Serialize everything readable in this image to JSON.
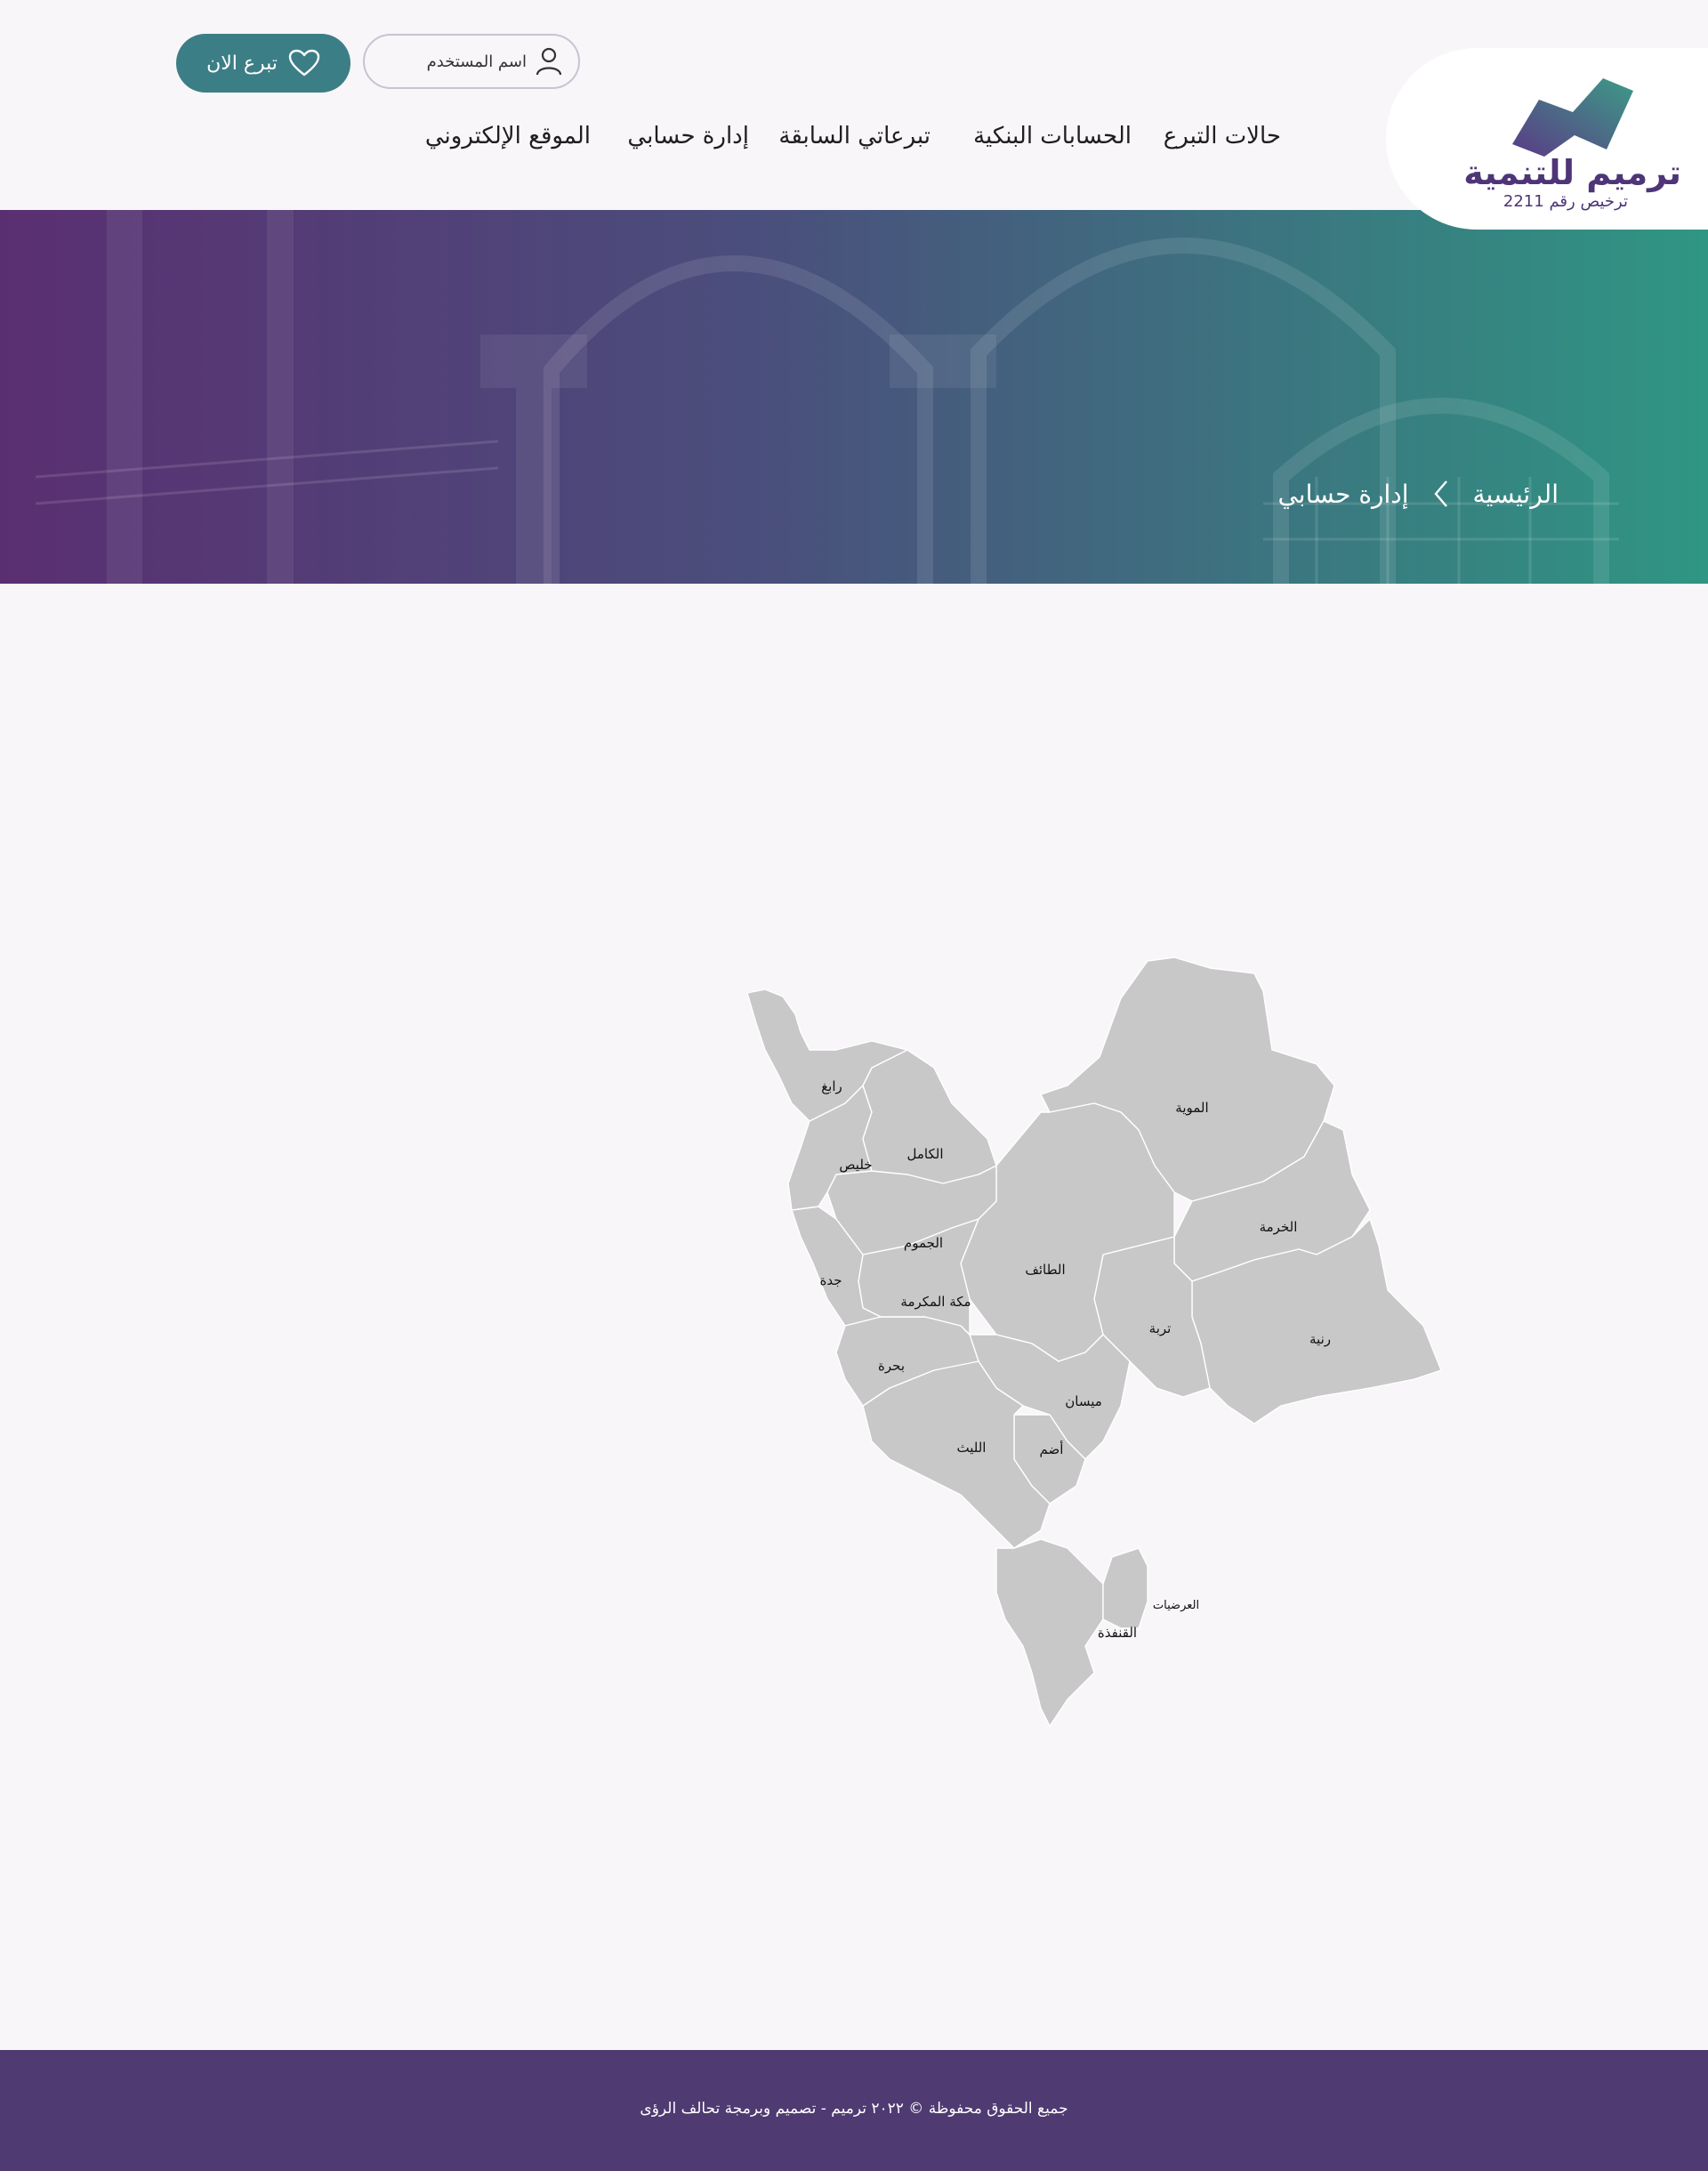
{
  "header": {
    "logo": {
      "title": "ترميم للتنمية",
      "subtitle": "ترخيص رقم 2211"
    },
    "nav": [
      {
        "label": "حالات التبرع"
      },
      {
        "label": "الحسابات البنكية"
      },
      {
        "label": "تبرعاتي السابقة"
      },
      {
        "label": "إدارة حسابي"
      },
      {
        "label": "الموقع الإلكتروني"
      }
    ],
    "user_button": {
      "label": "اسم المستخدم",
      "icon": "user-icon"
    },
    "donate_button": {
      "label": "تبرع الان",
      "icon": "heart-icon"
    },
    "colors": {
      "brand_purple": "#4e3577",
      "brand_teal": "#3c7e86"
    }
  },
  "hero": {
    "breadcrumb": {
      "home": "الرئيسية",
      "current": "إدارة حسابي",
      "separator_icon": "chevron-left-icon"
    }
  },
  "map": {
    "regions": [
      {
        "name": "رابغ"
      },
      {
        "name": "خليص"
      },
      {
        "name": "الكامل"
      },
      {
        "name": "الجموم"
      },
      {
        "name": "جدة"
      },
      {
        "name": "مكة المكرمة"
      },
      {
        "name": "بحرة"
      },
      {
        "name": "الطائف"
      },
      {
        "name": "الموية"
      },
      {
        "name": "الخرمة"
      },
      {
        "name": "تربة"
      },
      {
        "name": "رنية"
      },
      {
        "name": "ميسان"
      },
      {
        "name": "أضم"
      },
      {
        "name": "الليث"
      },
      {
        "name": "العرضيات"
      },
      {
        "name": "القنفذة"
      }
    ],
    "fill_color": "#c8c8c8",
    "border_color": "#ffffff"
  },
  "footer": {
    "text": "جميع الحقوق محفوظة © ٢٠٢٢ ترميم - تصميم وبرمجة تحالف الرؤى",
    "background": "#4f3a72"
  }
}
